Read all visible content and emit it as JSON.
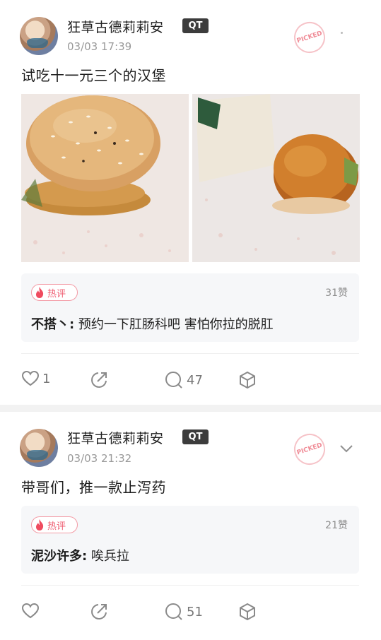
{
  "posts": [
    {
      "username": "狂草古德莉莉安",
      "badge": "QT",
      "time": "03/03 17:39",
      "picked_stamp": "PICKED",
      "text": "试吃十一元三个的汉堡",
      "images": [
        "burger-photo",
        "opened-burger-photo"
      ],
      "hot_comment": {
        "tag": "热评",
        "likes": "31赞",
        "author": "不搭丶:",
        "text": " 预约一下肛肠科吧 害怕你拉的脱肛"
      },
      "actions": {
        "like_count": "1",
        "comment_count": "47"
      }
    },
    {
      "username": "狂草古德莉莉安",
      "badge": "QT",
      "time": "03/03 21:32",
      "picked_stamp": "PICKED",
      "text": "带哥们，推一款止泻药",
      "hot_comment": {
        "tag": "热评",
        "likes": "21赞",
        "author": "泥沙许多:",
        "text": " 唉兵拉"
      },
      "actions": {
        "like_count": "",
        "comment_count": "51"
      }
    }
  ],
  "colors": {
    "accent_red": "#ef5f73",
    "badge_bg": "#3c3c3c",
    "muted": "#9a9a9a"
  },
  "icons": [
    "heart-icon",
    "share-icon",
    "comment-icon",
    "cube-icon",
    "flame-icon",
    "chevron-down-icon"
  ]
}
